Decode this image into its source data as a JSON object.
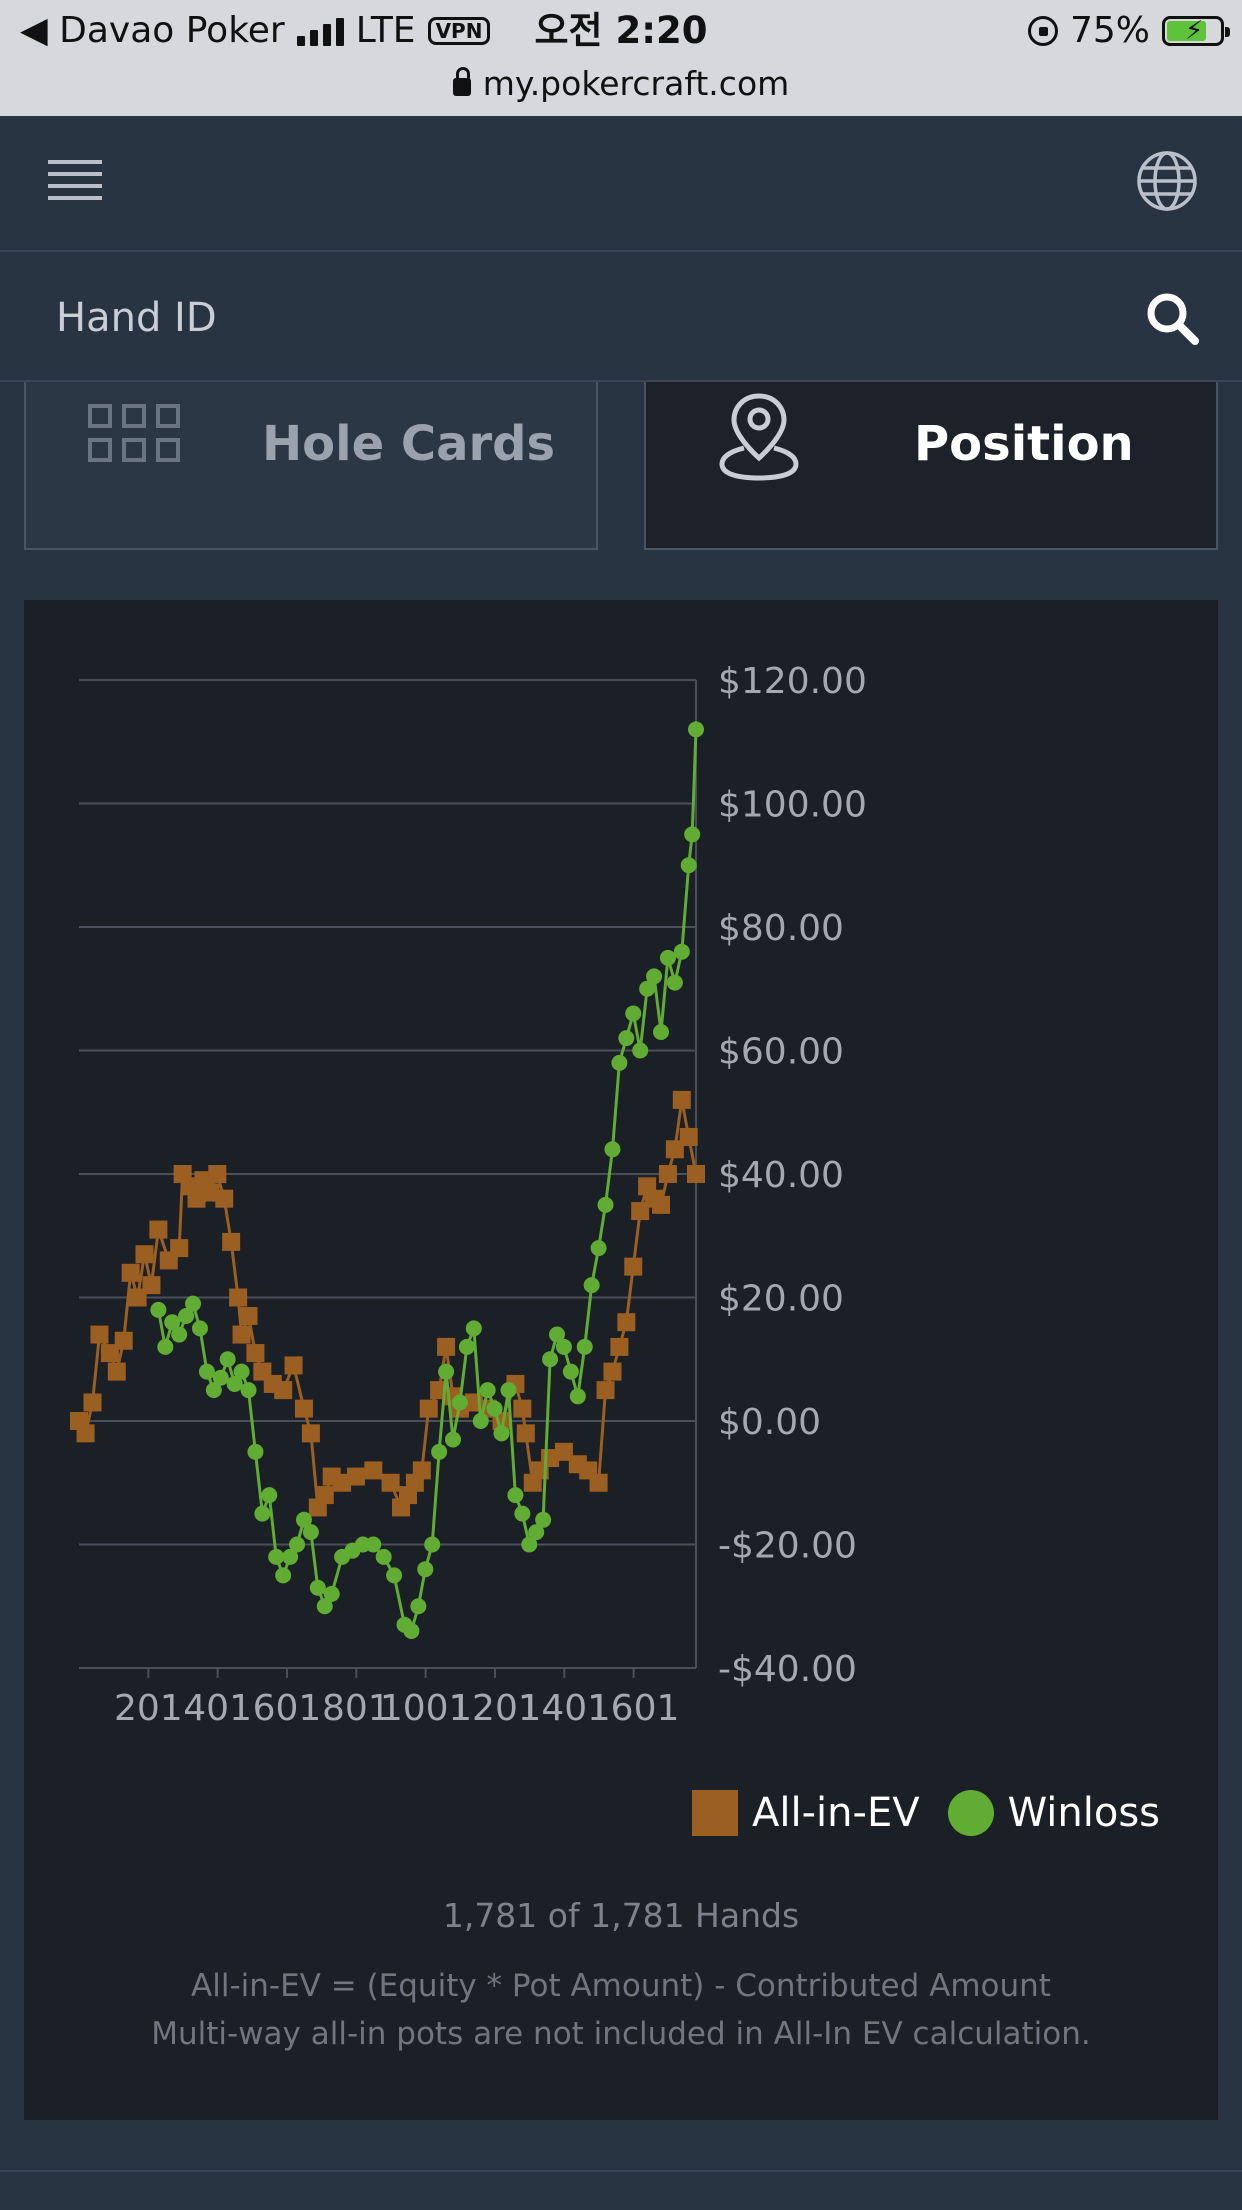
{
  "status_bar": {
    "back_label": "◀ Davao Poker",
    "network": "LTE",
    "vpn": "VPN",
    "time": "오전 2:20",
    "battery": "75%",
    "battery_level": 0.75,
    "url": "my.pokercraft.com"
  },
  "navbar": {
    "menu_icon": "hamburger-menu-icon",
    "globe_icon": "globe-icon"
  },
  "search": {
    "placeholder": "Hand ID",
    "icon": "search-icon"
  },
  "tabs": [
    {
      "label": "Hole Cards",
      "icon": "grid-icon",
      "active": false
    },
    {
      "label": "Position",
      "icon": "location-pin-icon",
      "active": true
    }
  ],
  "chart_data": {
    "type": "scatter",
    "x_ticks": [
      "201",
      "401",
      "601",
      "801",
      "1001",
      "1201",
      "1401",
      "1601"
    ],
    "y_ticks": [
      "$120.00",
      "$100.00",
      "$80.00",
      "$60.00",
      "$40.00",
      "$20.00",
      "$0.00",
      "-$20.00",
      "-$40.00"
    ],
    "xlim": [
      1,
      1781
    ],
    "ylim": [
      -40,
      120
    ],
    "grid": true,
    "legend_position": "bottom-right",
    "series": [
      {
        "name": "All-in-EV",
        "color": "#9b5f22",
        "marker": "square",
        "x": [
          1,
          20,
          40,
          60,
          90,
          110,
          130,
          150,
          170,
          190,
          210,
          230,
          260,
          290,
          300,
          320,
          340,
          360,
          380,
          400,
          420,
          440,
          460,
          470,
          490,
          510,
          530,
          560,
          590,
          620,
          650,
          670,
          690,
          710,
          730,
          760,
          800,
          850,
          900,
          930,
          950,
          970,
          990,
          1010,
          1040,
          1060,
          1080,
          1100,
          1140,
          1180,
          1220,
          1260,
          1280,
          1290,
          1310,
          1330,
          1360,
          1400,
          1440,
          1470,
          1500,
          1520,
          1540,
          1560,
          1580,
          1600,
          1620,
          1640,
          1660,
          1680,
          1700,
          1720,
          1740,
          1760,
          1781
        ],
        "values": [
          0,
          -2,
          3,
          14,
          11,
          8,
          13,
          24,
          20,
          27,
          22,
          31,
          26,
          28,
          40,
          38,
          36,
          39,
          37,
          40,
          36,
          29,
          20,
          14,
          17,
          11,
          8,
          6,
          5,
          9,
          2,
          -2,
          -14,
          -12,
          -9,
          -10,
          -9,
          -8,
          -10,
          -14,
          -12,
          -10,
          -8,
          2,
          5,
          12,
          4,
          2,
          3,
          2,
          0,
          6,
          2,
          -2,
          -10,
          -8,
          -6,
          -5,
          -7,
          -8,
          -10,
          5,
          8,
          12,
          16,
          25,
          34,
          38,
          36,
          35,
          40,
          44,
          52,
          46,
          40
        ]
      },
      {
        "name": "Winloss",
        "color": "#61ad33",
        "marker": "circle",
        "x": [
          230,
          250,
          270,
          290,
          310,
          330,
          350,
          370,
          390,
          410,
          430,
          450,
          470,
          490,
          510,
          530,
          550,
          570,
          590,
          610,
          630,
          650,
          670,
          690,
          710,
          730,
          760,
          790,
          820,
          850,
          880,
          910,
          940,
          960,
          980,
          1000,
          1020,
          1040,
          1060,
          1080,
          1100,
          1120,
          1140,
          1160,
          1180,
          1200,
          1220,
          1240,
          1260,
          1280,
          1300,
          1320,
          1340,
          1360,
          1380,
          1400,
          1420,
          1440,
          1460,
          1480,
          1500,
          1520,
          1540,
          1560,
          1580,
          1600,
          1620,
          1640,
          1660,
          1680,
          1700,
          1720,
          1740,
          1760,
          1770,
          1781
        ],
        "values": [
          18,
          12,
          16,
          14,
          17,
          19,
          15,
          8,
          5,
          7,
          10,
          6,
          8,
          5,
          -5,
          -15,
          -12,
          -22,
          -25,
          -22,
          -20,
          -16,
          -18,
          -27,
          -30,
          -28,
          -22,
          -21,
          -20,
          -20,
          -22,
          -25,
          -33,
          -34,
          -30,
          -24,
          -20,
          -5,
          8,
          -3,
          3,
          12,
          15,
          0,
          5,
          2,
          -2,
          5,
          -12,
          -15,
          -20,
          -18,
          -16,
          10,
          14,
          12,
          8,
          4,
          12,
          22,
          28,
          35,
          44,
          58,
          62,
          66,
          60,
          70,
          72,
          63,
          75,
          71,
          76,
          90,
          95,
          112
        ]
      }
    ]
  },
  "legend": {
    "ev_label": "All-in-EV",
    "winloss_label": "Winloss"
  },
  "footer": {
    "hands_count": "1,781 of 1,781 Hands",
    "note_line1": "All-in-EV = (Equity * Pot Amount) - Contributed Amount",
    "note_line2": "Multi-way all-in pots are not included in All-In EV calculation."
  }
}
